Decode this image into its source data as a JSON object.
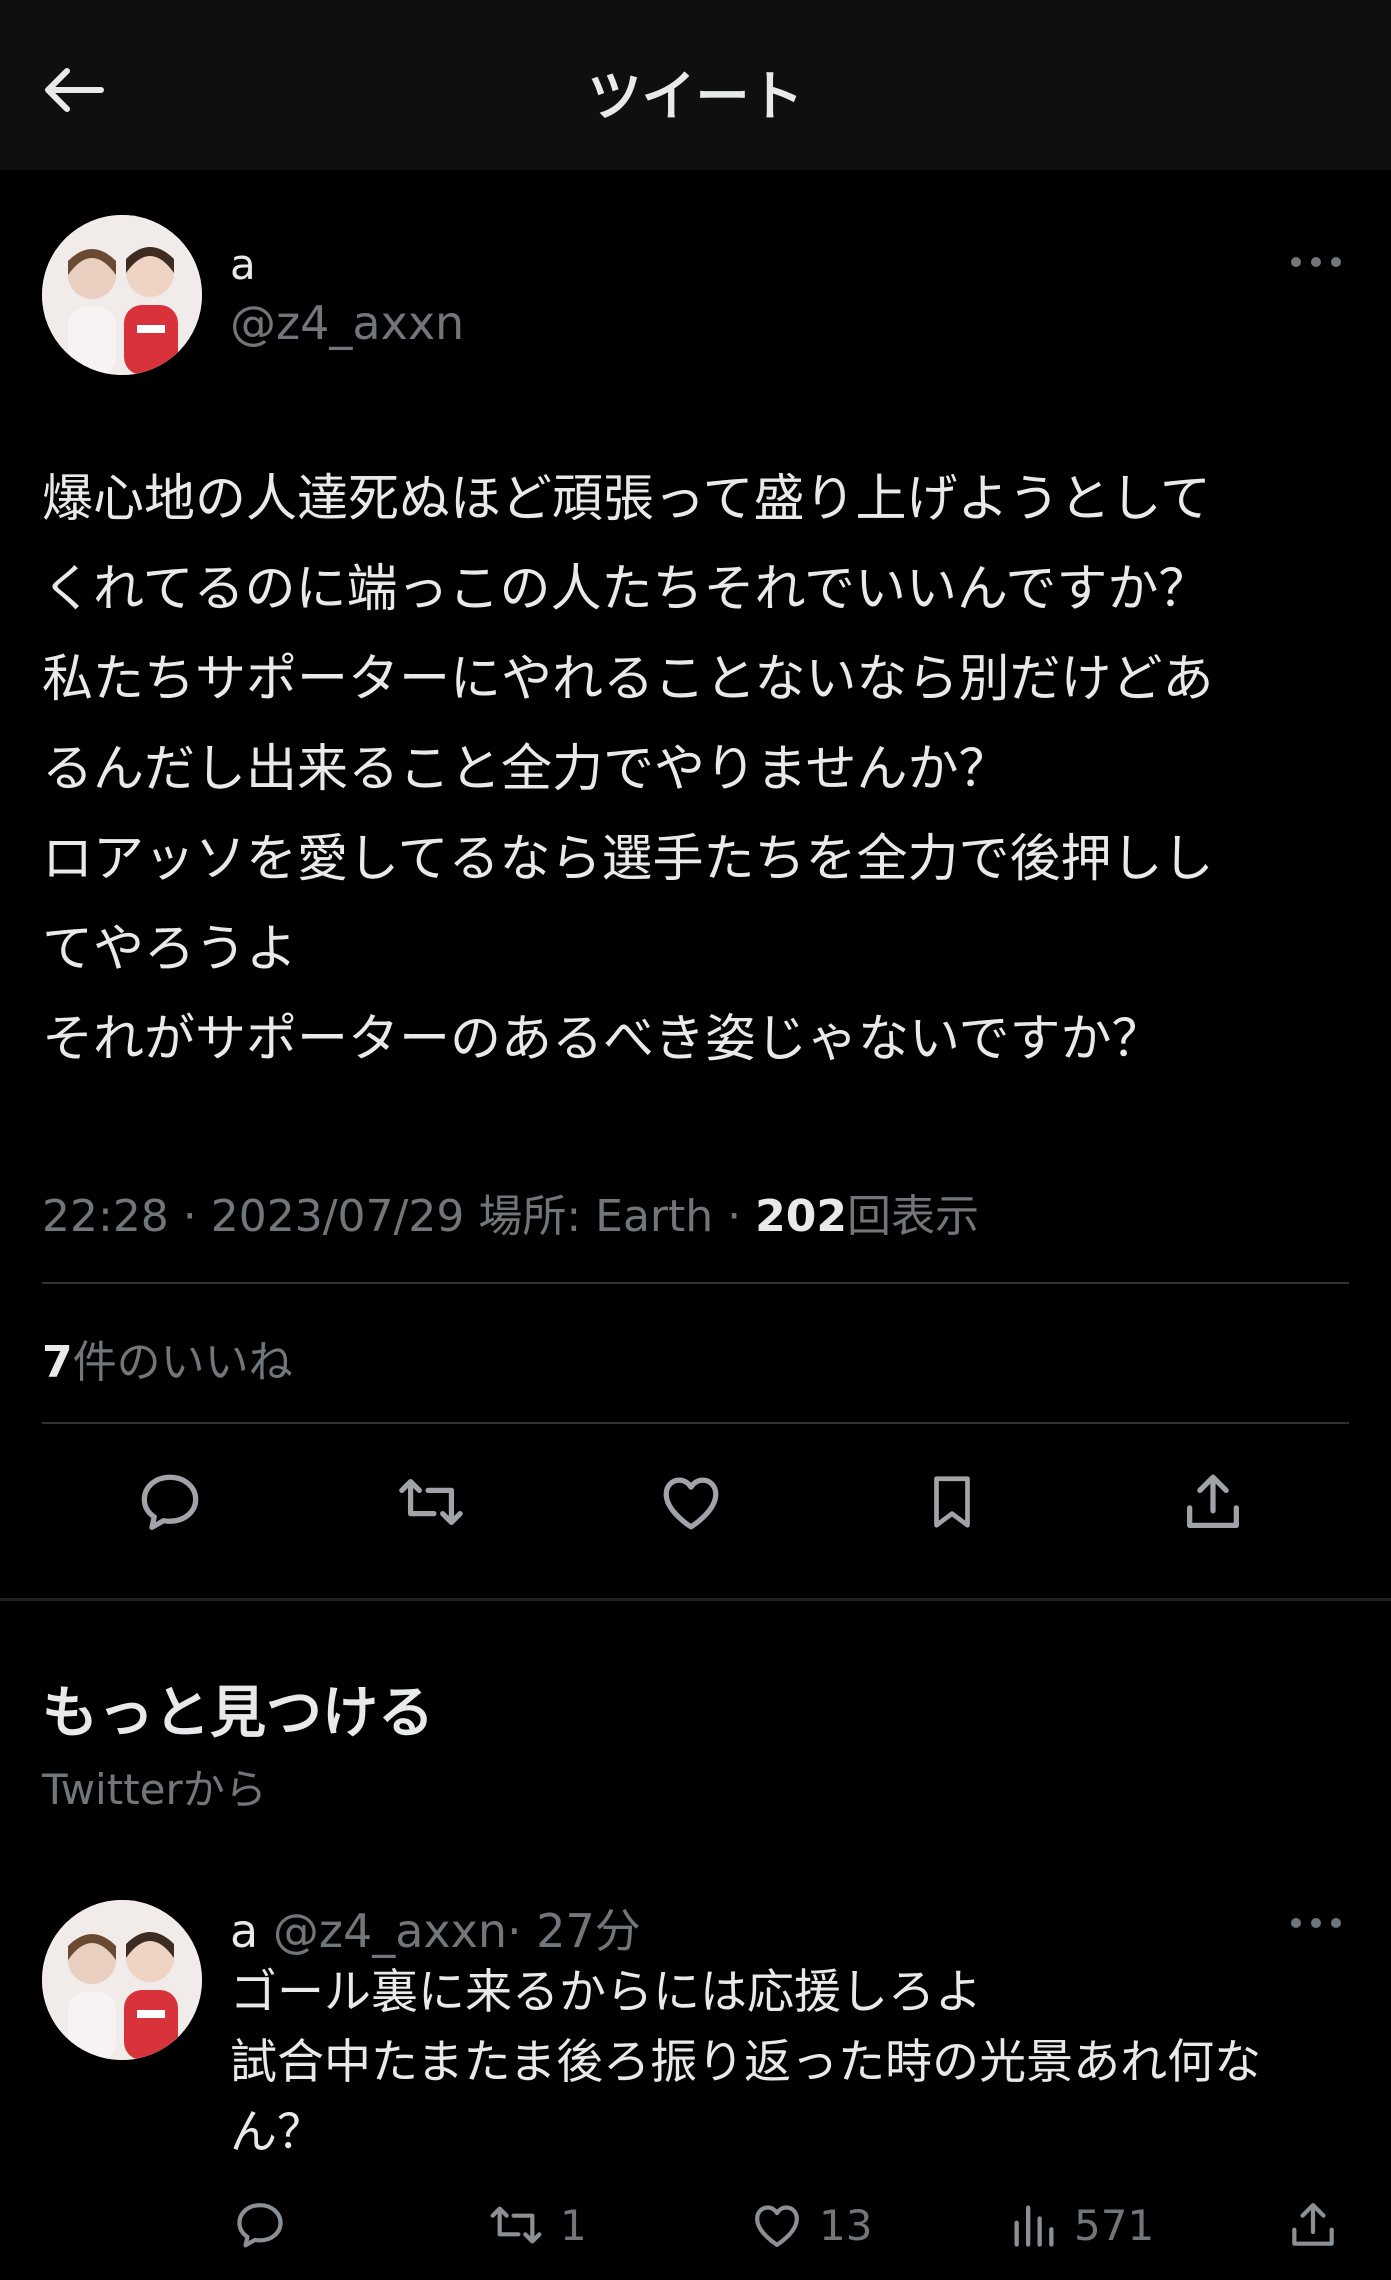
{
  "header": {
    "title": "ツイート"
  },
  "tweet": {
    "display_name": "a",
    "handle": "@z4_axxn",
    "text": "爆心地の人達死ぬほど頑張って盛り上げようとして\nくれてるのに端っこの人たちそれでいいんですか？\n私たちサポーターにやれることないなら別だけどあ\nるんだし出来ること全力でやりませんか？\nロアッソを愛してるなら選手たちを全力で後押しし\nてやろうよ\nそれがサポーターのあるべき姿じゃないですか？",
    "meta_prefix": "22:28 · 2023/07/29 場所: Earth · ",
    "views_count": "202",
    "views_label": "回表示",
    "likes_count": "7",
    "likes_label": "件のいいね"
  },
  "actions": {
    "icons": [
      "reply-icon",
      "retweet-icon",
      "like-icon",
      "bookmark-icon",
      "share-icon"
    ]
  },
  "discover": {
    "title": "もっと見つける",
    "subtitle": "Twitterから"
  },
  "recommended": {
    "name": "a",
    "handle": "@z4_axxn",
    "time": "· 27分",
    "text": "ゴール裏に来るからには応援しろよ\n試合中たまたま後ろ振り返った時の光景あれ何な\nん？",
    "retweets": "1",
    "likes": "13",
    "views": "571"
  },
  "colors": {
    "background": "#000000",
    "header_bg": "#0f0f0f",
    "text": "#e7e9ea",
    "secondary": "#71767b",
    "divider": "#2f3336"
  }
}
